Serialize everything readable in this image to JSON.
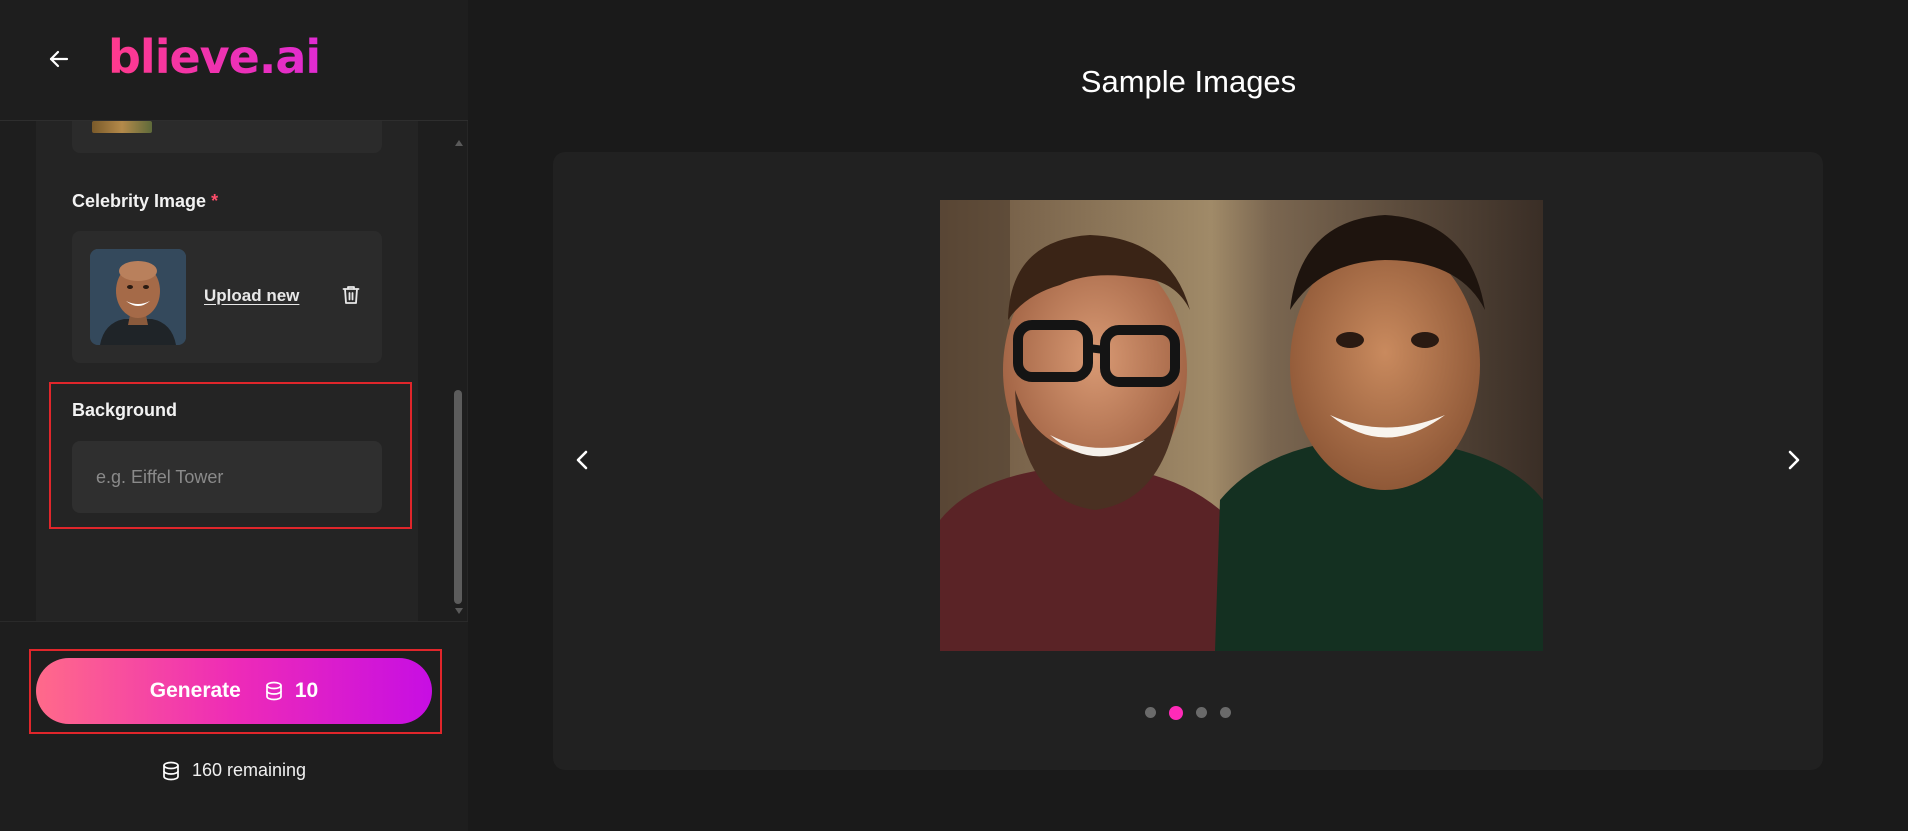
{
  "header": {
    "logo_text": "blieve.ai"
  },
  "form": {
    "celebrity_label": "Celebrity Image",
    "required_mark": "*",
    "upload_new_label": "Upload new",
    "background_label": "Background",
    "background_placeholder": "e.g. Eiffel Tower",
    "background_value": ""
  },
  "footer": {
    "generate_label": "Generate",
    "generate_cost": "10",
    "remaining_text": "160 remaining"
  },
  "main": {
    "title": "Sample Images",
    "dots": [
      {
        "active": false
      },
      {
        "active": true
      },
      {
        "active": false
      },
      {
        "active": false
      }
    ]
  },
  "colors": {
    "accent_pink": "#ff2ab8",
    "accent_purple": "#c70ee3",
    "highlight_red": "#e0262b"
  },
  "icons": [
    "arrow-left-icon",
    "trash-icon",
    "coins-icon",
    "chevron-left-icon",
    "chevron-right-icon"
  ]
}
